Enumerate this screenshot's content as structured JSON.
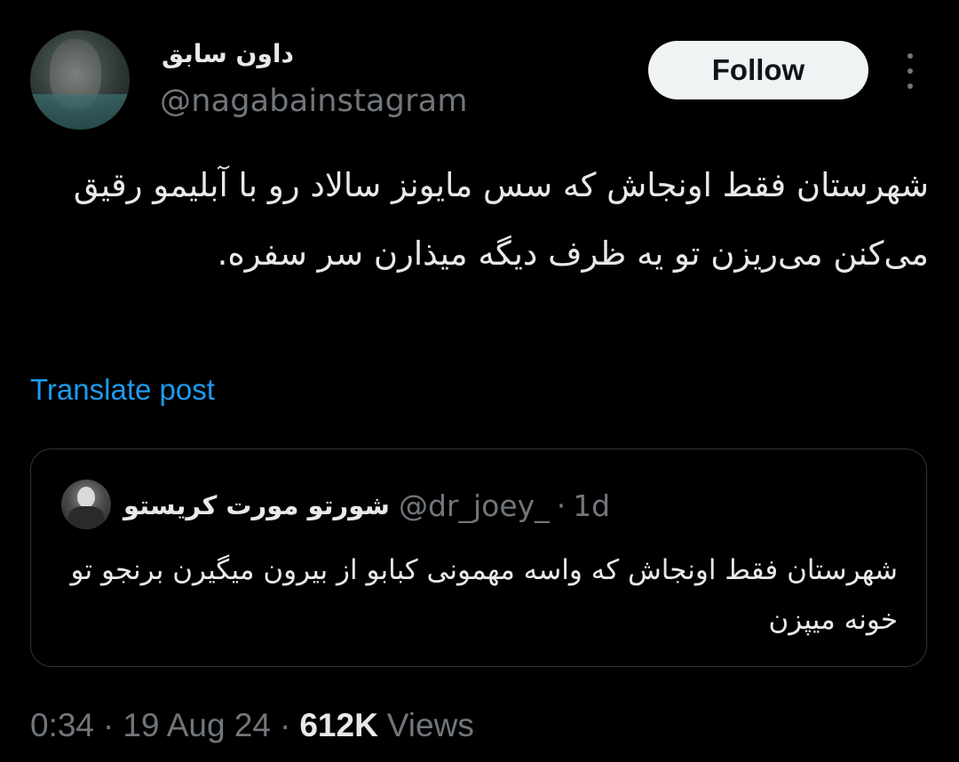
{
  "author": {
    "display_name": "داون سابق",
    "handle": "@nagabainstagram",
    "avatar_icon": "blurred-profile-photo"
  },
  "actions": {
    "follow_label": "Follow",
    "more_icon": "vertical-ellipsis-icon"
  },
  "tweet": {
    "text": "شهرستان فقط اونجاش که سس مایونز سالاد رو با آبلیمو رقیق می‌کنن می‌ریزن تو یه ظرف دیگه میذارن سر سفره.",
    "translate_label": "Translate post"
  },
  "quote": {
    "display_name": "شورتو مورت کریستو",
    "handle": "@dr_joey_",
    "separator": "·",
    "time": "1d",
    "text": "شهرستان فقط اونجاش که واسه مهمونی کبابو از بیرون میگیرن برنجو تو خونه میپزن"
  },
  "meta": {
    "time": "0:34",
    "separator": "·",
    "date": "19 Aug 24",
    "views_count": "612K",
    "views_label": "Views"
  },
  "colors": {
    "background": "#000000",
    "primary_text": "#e7e9ea",
    "secondary_text": "#71767b",
    "link": "#1d9bf0",
    "follow_button_bg": "#eff3f4",
    "border": "#2f3336"
  }
}
